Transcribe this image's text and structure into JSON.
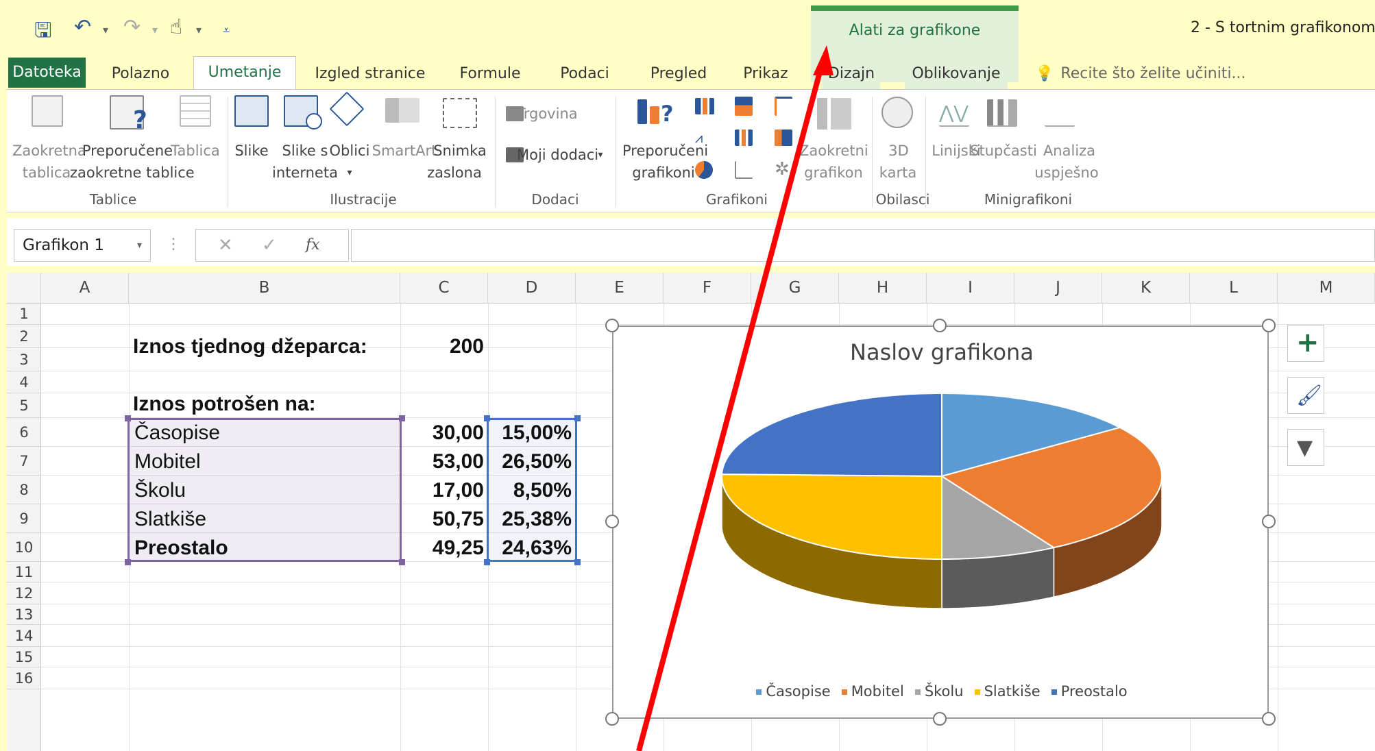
{
  "app": {
    "doc_title": "2 - S tortnim grafikonom.",
    "context_title": "Alati za grafikone"
  },
  "tabs": {
    "file": "Datoteka",
    "home": "Polazno",
    "insert": "Umetanje",
    "layout": "Izgled stranice",
    "formulas": "Formule",
    "data": "Podaci",
    "review": "Pregled",
    "view": "Prikaz",
    "design": "Dizajn",
    "format": "Oblikovanje",
    "tell": "Recite što želite učiniti..."
  },
  "ribbon": {
    "pivot": [
      "Zaokretna",
      "tablica"
    ],
    "rec_pivot": [
      "Preporučene",
      "zaokretne tablice"
    ],
    "table": "Tablica",
    "group_tables": "Tablice",
    "pictures": "Slike",
    "online_pictures": [
      "Slike s",
      "interneta"
    ],
    "shapes": "Oblici",
    "smartart": "SmartArt",
    "screenshot": [
      "Snimka",
      "zaslona"
    ],
    "group_illustrations": "Ilustracije",
    "store": "Trgovina",
    "my_addins": "Moji dodaci",
    "group_addins": "Dodaci",
    "rec_charts": [
      "Preporučeni",
      "grafikoni"
    ],
    "pivot_chart": [
      "Zaokretni",
      "grafikon"
    ],
    "group_charts": "Grafikoni",
    "map3d": [
      "3D",
      "karta"
    ],
    "group_tours": "Obilasci",
    "line": "Linijski",
    "column": "Stupčasti",
    "winloss": [
      "Analiza",
      "uspješno"
    ],
    "group_sparklines": "Minigrafikoni"
  },
  "formula_bar": {
    "name_box": "Grafikon 1",
    "fx": "fx"
  },
  "columns": [
    "A",
    "B",
    "C",
    "D",
    "E",
    "F",
    "G",
    "H",
    "I",
    "J",
    "K",
    "L",
    "M"
  ],
  "rows": [
    "1",
    "2",
    "3",
    "4",
    "5",
    "6",
    "7",
    "8",
    "9",
    "10",
    "11",
    "12",
    "13",
    "14",
    "15",
    "16"
  ],
  "cells": {
    "b2": "Iznos tjednog džeparca:",
    "c2": "200",
    "b4": "Iznos potrošen na:",
    "items": [
      {
        "label": "Časopise",
        "amount": "30,00",
        "pct": "15,00%"
      },
      {
        "label": "Mobitel",
        "amount": "53,00",
        "pct": "26,50%"
      },
      {
        "label": "Školu",
        "amount": "17,00",
        "pct": "8,50%"
      },
      {
        "label": "Slatkiše",
        "amount": "50,75",
        "pct": "25,38%"
      },
      {
        "label": "Preostalo",
        "amount": "49,25",
        "pct": "24,63%"
      }
    ]
  },
  "chart_data": {
    "type": "pie",
    "title": "Naslov grafikona",
    "categories": [
      "Časopise",
      "Mobitel",
      "Školu",
      "Slatkiše",
      "Preostalo"
    ],
    "values": [
      30.0,
      53.0,
      17.0,
      50.75,
      49.25
    ],
    "colors": [
      "#5b9bd5",
      "#ed7d31",
      "#a5a5a5",
      "#ffc000",
      "#4472c4"
    ],
    "legend": "bottom"
  }
}
